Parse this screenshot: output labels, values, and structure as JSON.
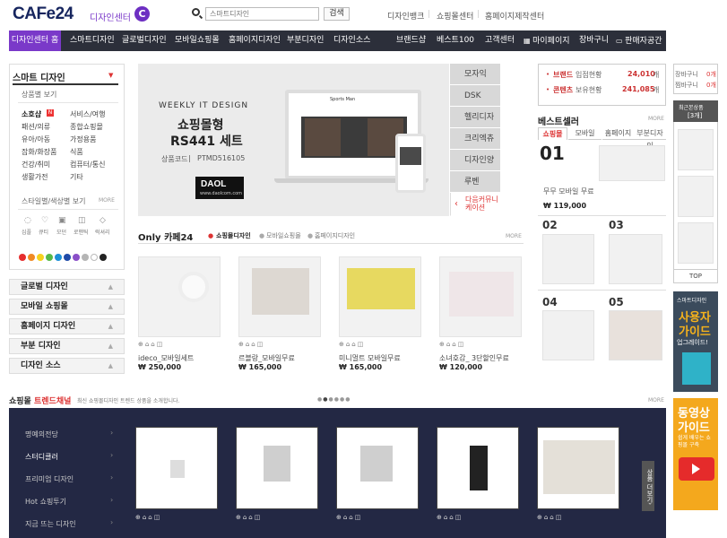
{
  "header": {
    "logo": "CAFe24",
    "logo_sub": "디자인센터",
    "logo_badge": "C",
    "search_placeholder": "스마트디자인",
    "search_btn": "검색",
    "links": [
      "디자인뱅크",
      "쇼핑몰센터",
      "홈페이지제작센터"
    ]
  },
  "nav": {
    "items": [
      "디자인센터 홈",
      "스마트디자인",
      "글로벌디자인",
      "모바일쇼핑몰",
      "홈페이지디자인",
      "부분디자인",
      "디자인소스",
      "브랜드샵",
      "베스트100",
      "고객센터",
      "마이페이지",
      "장바구니",
      "판매자공간"
    ]
  },
  "left": {
    "title": "스마트 디자인",
    "sub1": "상품별 보기",
    "col1": [
      "소호샵",
      "패션/의류",
      "유아/아동",
      "잡화/화장품",
      "건강/취미",
      "생활가전"
    ],
    "new_badge": "N",
    "col2": [
      "서비스/여행",
      "종합쇼핑몰",
      "가정용품",
      "식품",
      "컴퓨터/통신",
      "기타"
    ],
    "sub2": "스타일별/색상별 보기",
    "more": "MORE",
    "styles": [
      "심플",
      "큐티",
      "모던",
      "로맨틱",
      "럭셔리"
    ],
    "colors": [
      "#e62e2e",
      "#f08a24",
      "#f5d21e",
      "#56b84a",
      "#1e8fd8",
      "#1f4aa8",
      "#8a4fc8",
      "#b5b5b5",
      "#ffffff",
      "#222222"
    ],
    "cats": [
      "글로벌 디자인",
      "모바일 쇼핑몰",
      "홈페이지 디자인",
      "부분 디자인",
      "디자인 소스"
    ]
  },
  "banner": {
    "kicker": "WEEKLY IT DESIGN",
    "title1": "쇼핑몰형",
    "title2": "RS441 세트",
    "code_label": "상품코드",
    "code": "PTMD516105",
    "brand": "DAOL",
    "brand_url": "www.daolcom.com",
    "site_title": "Sports Man",
    "tabs": [
      "모자익",
      "DSK",
      "헬리디자인",
      "크리엑츄얼",
      "디자인양지",
      "루벤",
      "다음커뮤니케이션"
    ]
  },
  "stats": {
    "brand_label": "브랜드",
    "brand_text": "입점현황",
    "brand_val": "24,010",
    "content_label": "콘텐츠",
    "content_text": "보유현황",
    "content_val": "241,085",
    "unit": "개"
  },
  "best": {
    "title": "베스트셀러",
    "more": "MORE",
    "tabs": [
      "쇼핑몰",
      "모바일",
      "홈페이지",
      "부분디자인"
    ],
    "first_rank": "01",
    "first_name": "무무 모바일 무료",
    "first_price": "119,000",
    "ranks": [
      "02",
      "03",
      "04",
      "05"
    ]
  },
  "cart": {
    "label1": "장바구니",
    "val1": "0개",
    "label2": "찜바구니",
    "val2": "0개",
    "recent": "최근본상품",
    "recent_count": "[3개]",
    "top": "TOP"
  },
  "only": {
    "title_a": "Only",
    "title_b": "카페24",
    "tabs": [
      "쇼핑몰디자인",
      "모바일쇼핑몰",
      "홈페이지디자인"
    ],
    "more": "MORE",
    "products": [
      {
        "name": "ideco_모바일세트",
        "price": "250,000"
      },
      {
        "name": "르블랑_모바일무료",
        "price": "165,000"
      },
      {
        "name": "미니멀트 모바일무료",
        "price": "165,000"
      },
      {
        "name": "소녀호감_ 3단할인무료",
        "price": "120,000"
      }
    ],
    "currency": "₩"
  },
  "trend": {
    "title_a": "쇼핑몰",
    "title_b": "트렌드채널",
    "desc": "최신 쇼핑몰디자인 트렌드 상품을 소개합니다.",
    "more": "MORE",
    "menu": [
      "명예의전당",
      "스터디클러",
      "프리미엄 디자인",
      "Hot 쇼핑투기",
      "지금 뜨는 디자인"
    ],
    "side_btn": "상품 더보기"
  },
  "ads": {
    "ad1_top": "스마트디자인",
    "ad1_a": "사용자",
    "ad1_b": "가이드",
    "ad1_c": "업그레이드!",
    "ad2_a": "동영상",
    "ad2_b": "가이드",
    "ad2_c": "쉽게 배우는 쇼핑몰 구축"
  }
}
